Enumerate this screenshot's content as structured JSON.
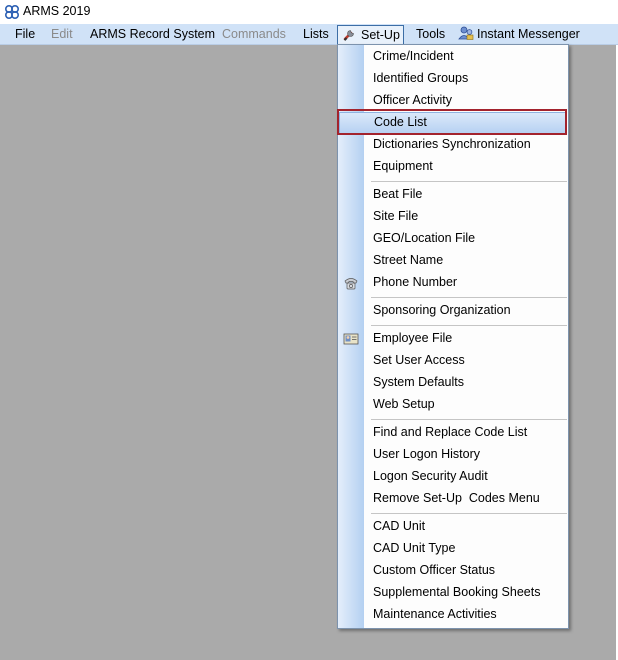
{
  "window": {
    "title": "ARMS 2019",
    "app_icon": "arms-logo-icon"
  },
  "menubar": {
    "items": [
      {
        "label": "File",
        "disabled": false
      },
      {
        "label": "Edit",
        "disabled": true
      },
      {
        "label": "ARMS Record System",
        "disabled": false
      },
      {
        "label": "Commands",
        "disabled": true
      },
      {
        "label": "Lists",
        "disabled": false
      },
      {
        "label": "Set-Up",
        "disabled": false,
        "open": true,
        "icon": "wrench-icon"
      },
      {
        "label": "Tools",
        "disabled": false
      },
      {
        "label": "Instant Messenger",
        "disabled": false,
        "icon": "messenger-people-icon"
      }
    ]
  },
  "setup_menu": {
    "items": [
      {
        "label": "Crime/Incident"
      },
      {
        "label": "Identified Groups"
      },
      {
        "label": "Officer Activity"
      },
      {
        "label": "Code List",
        "highlighted": true
      },
      {
        "label": "Dictionaries Synchronization"
      },
      {
        "label": "Equipment"
      },
      {
        "label": "Beat File"
      },
      {
        "label": "Site File"
      },
      {
        "label": "GEO/Location File"
      },
      {
        "label": "Street Name"
      },
      {
        "label": "Phone Number",
        "icon": "telephone-icon"
      },
      {
        "label": "Sponsoring Organization"
      },
      {
        "label": "Employee File",
        "icon": "employee-card-icon"
      },
      {
        "label": "Set User Access"
      },
      {
        "label": "System Defaults"
      },
      {
        "label": "Web Setup"
      },
      {
        "label": "Find and Replace Code List"
      },
      {
        "label": "User Logon History"
      },
      {
        "label": "Logon Security Audit"
      },
      {
        "label": "Remove Set-Up  Codes Menu"
      },
      {
        "label": "CAD Unit"
      },
      {
        "label": "CAD Unit Type"
      },
      {
        "label": "Custom Officer Status"
      },
      {
        "label": "Supplemental Booking Sheets"
      },
      {
        "label": "Maintenance Activities"
      }
    ]
  },
  "colors": {
    "menubar_bg": "#d0e2f7",
    "workspace_bg": "#aaaaaa",
    "highlight_outline": "#a3232d"
  }
}
